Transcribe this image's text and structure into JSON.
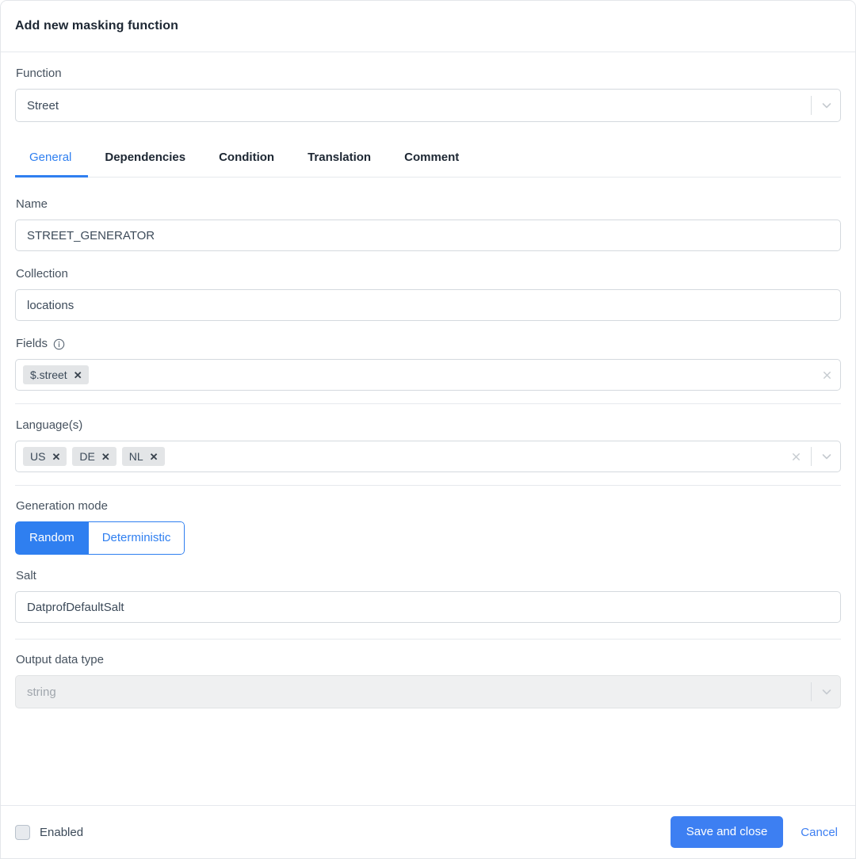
{
  "header": {
    "title": "Add new masking function"
  },
  "function_field": {
    "label": "Function",
    "value": "Street",
    "chevron_icon": "chevron-down-icon"
  },
  "tabs": [
    {
      "label": "General",
      "active": true
    },
    {
      "label": "Dependencies",
      "active": false
    },
    {
      "label": "Condition",
      "active": false
    },
    {
      "label": "Translation",
      "active": false
    },
    {
      "label": "Comment",
      "active": false
    }
  ],
  "name_field": {
    "label": "Name",
    "value": "STREET_GENERATOR"
  },
  "collection_field": {
    "label": "Collection",
    "value": "locations"
  },
  "fields_field": {
    "label": "Fields",
    "info_icon": "info-circle-icon",
    "chips": [
      {
        "label": "$.street",
        "remove_icon": "close-icon"
      }
    ],
    "clear_icon": "close-icon"
  },
  "languages_field": {
    "label": "Language(s)",
    "chips": [
      {
        "label": "US",
        "remove_icon": "close-icon"
      },
      {
        "label": "DE",
        "remove_icon": "close-icon"
      },
      {
        "label": "NL",
        "remove_icon": "close-icon"
      }
    ],
    "clear_icon": "close-icon",
    "chevron_icon": "chevron-down-icon"
  },
  "generation_mode": {
    "label": "Generation mode",
    "options": [
      {
        "label": "Random",
        "active": true
      },
      {
        "label": "Deterministic",
        "active": false
      }
    ]
  },
  "salt_field": {
    "label": "Salt",
    "value": "DatprofDefaultSalt"
  },
  "output_type_field": {
    "label": "Output data type",
    "value": "string",
    "disabled": true,
    "chevron_icon": "chevron-down-icon"
  },
  "footer": {
    "enabled_label": "Enabled",
    "enabled_checked": false,
    "save_label": "Save and close",
    "cancel_label": "Cancel"
  },
  "colors": {
    "accent": "#3d7ff2",
    "tab_active": "#2f7ff0",
    "chip_bg": "#e3e5e7",
    "border": "#d4d9de",
    "divider": "#e6e9ed",
    "disabled_bg": "#eff0f1"
  }
}
